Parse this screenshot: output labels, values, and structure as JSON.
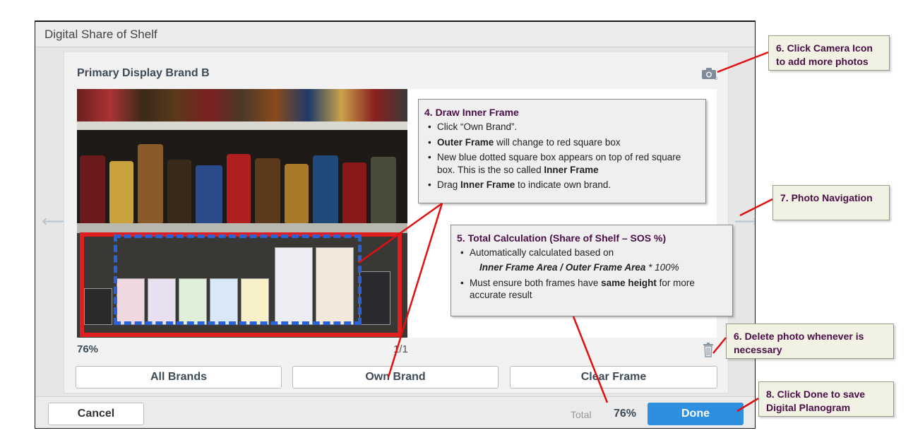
{
  "window": {
    "title": "Digital Share of Shelf"
  },
  "card": {
    "title": "Primary Display Brand B"
  },
  "photo": {
    "percent": "76%",
    "page": "1/1"
  },
  "buttons": {
    "all_brands": "All Brands",
    "own_brand": "Own Brand",
    "clear_frame": "Clear Frame"
  },
  "footer": {
    "cancel": "Cancel",
    "total_label": "Total",
    "total_value": "76%",
    "done": "Done"
  },
  "annotations": {
    "draw_inner": {
      "title": "4. Draw Inner Frame",
      "b1": "Click “Own Brand”.",
      "b2_bold": "Outer Frame",
      "b2_rest": " will change to red square box",
      "b3_pre": "New blue dotted square box appears on top of red square box. This is the so called ",
      "b3_bold": "Inner Frame",
      "b4_pre": "Drag ",
      "b4_bold": "Inner Frame",
      "b4_rest": " to indicate own brand."
    },
    "total_calc": {
      "title": "5. Total Calculation (Share of Shelf – SOS %)",
      "b1": "Automatically calculated based on",
      "formula": "Inner Frame Area / Outer Frame Area",
      "formula_suffix": " * 100%",
      "b2_pre": "Must ensure both frames have ",
      "b2_bold": "same height",
      "b2_rest": " for more accurate result"
    },
    "camera": "6. Click Camera Icon to add more photos",
    "navigation": "7. Photo Navigation",
    "delete": "6. Delete photo whenever is necessary",
    "done": "8. Click Done to save Digital Planogram"
  },
  "icons": {
    "camera": "camera-icon",
    "trash": "trash-icon",
    "left": "arrow-left-icon",
    "right": "arrow-right-icon"
  },
  "colors": {
    "accent": "#2e8fe0",
    "outer_frame": "#e02020",
    "inner_frame": "#2a63d9",
    "callout_text": "#4b0e47",
    "leader": "#e01010"
  }
}
